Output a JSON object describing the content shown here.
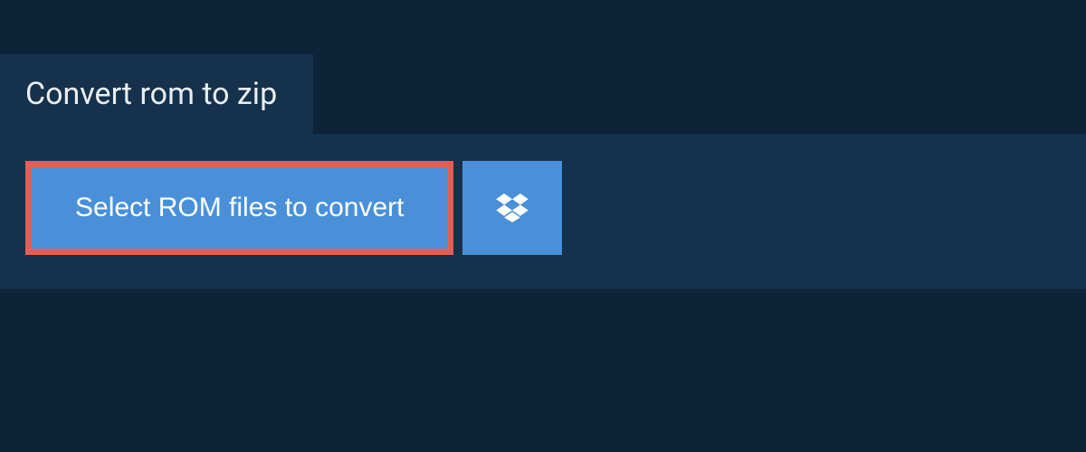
{
  "header": {
    "title": "Convert rom to zip"
  },
  "actions": {
    "select_label": "Select ROM files to convert",
    "dropbox_icon_name": "dropbox-icon"
  },
  "colors": {
    "background": "#0d2438",
    "panel": "#15314b",
    "button": "#4a90d9",
    "highlight_border": "#e35f55",
    "text_light": "#e8eef3",
    "text_white": "#ffffff"
  }
}
